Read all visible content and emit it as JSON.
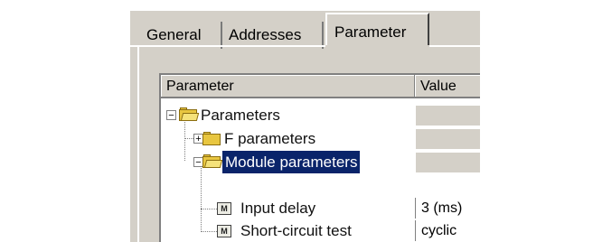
{
  "tabs": [
    {
      "label": "General"
    },
    {
      "label": "Addresses"
    },
    {
      "label": "Parameter"
    }
  ],
  "table": {
    "headers": {
      "parameter": "Parameter",
      "value": "Value"
    },
    "rows": [
      {
        "label": "Parameters",
        "value": "",
        "toggle": "−"
      },
      {
        "label": "F parameters",
        "value": "",
        "toggle": "+"
      },
      {
        "label": "Module parameters",
        "value": "",
        "toggle": "−"
      },
      {
        "label": "Input delay",
        "value": "3 (ms)"
      },
      {
        "label": "Short-circuit test",
        "value": "cyclic"
      }
    ]
  },
  "colors": {
    "selection": "#0a246a",
    "dialog": "#d4d0c8"
  }
}
